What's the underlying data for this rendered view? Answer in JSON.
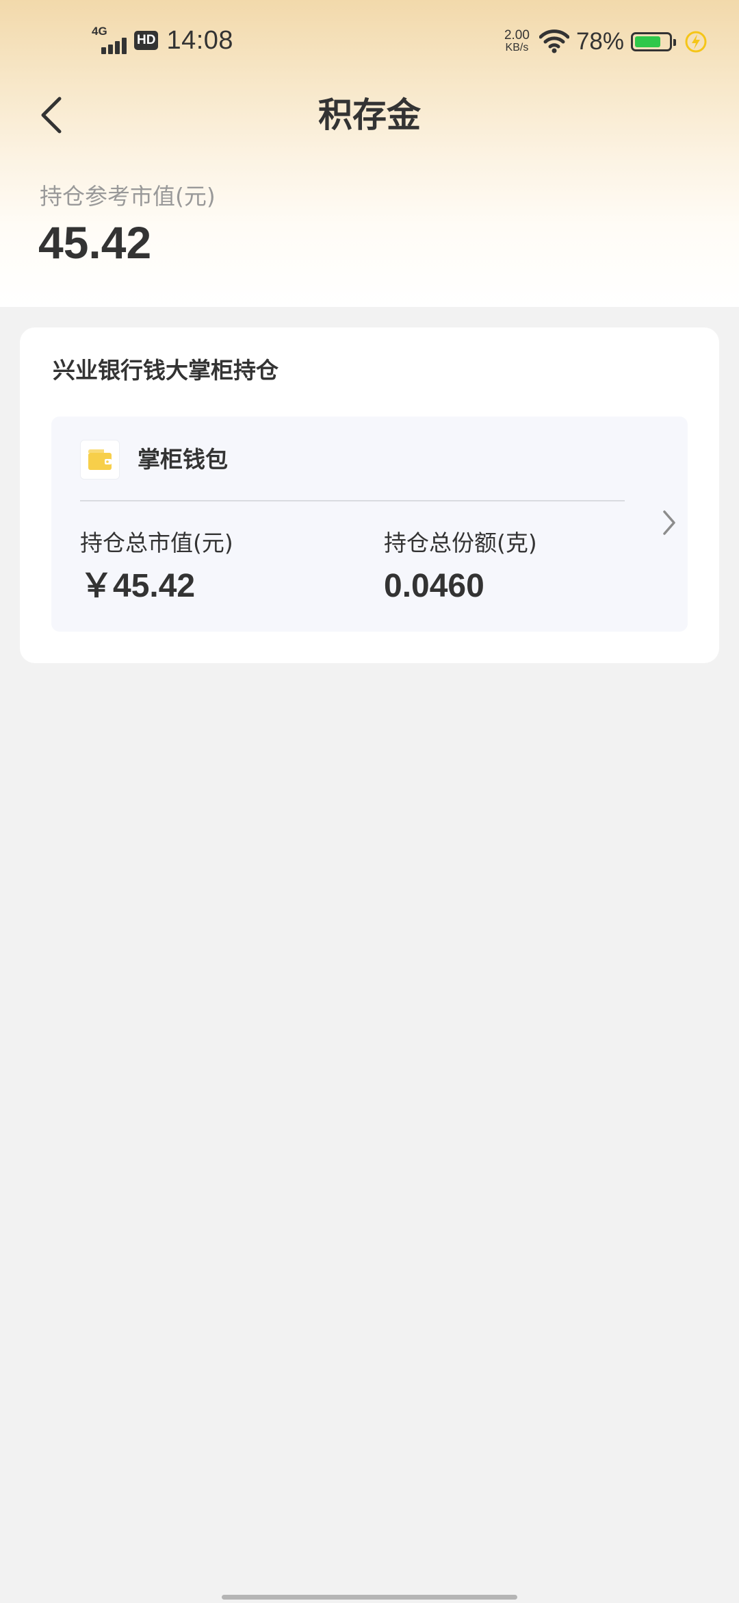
{
  "status_bar": {
    "network": "4G",
    "hd": "HD",
    "time": "14:08",
    "speed_value": "2.00",
    "speed_unit": "KB/s",
    "battery_percent": "78%",
    "battery_level": 0.78,
    "battery_fill_color": "#2fc84a",
    "charging_icon": "lightning-bolt-icon",
    "charging_color": "#f5c518"
  },
  "header": {
    "title": "积存金",
    "back_icon": "chevron-left-icon"
  },
  "summary": {
    "label": "持仓参考市值(元)",
    "value": "45.42"
  },
  "holdings_card": {
    "title": "兴业银行钱大掌柜持仓",
    "wallet": {
      "icon": "wallet-icon",
      "icon_color": "#f7cf4a",
      "name": "掌柜钱包",
      "total_value_label": "持仓总市值(元)",
      "total_value": "￥45.42",
      "total_amount_label": "持仓总份额(克)",
      "total_amount": "0.0460",
      "chevron_icon": "chevron-right-icon"
    }
  },
  "colors": {
    "header_gradient_top": "#f2d9ab",
    "page_background": "#f2f2f2",
    "panel_background": "#f6f7fc",
    "text_primary": "#333333",
    "text_secondary": "#999999"
  }
}
